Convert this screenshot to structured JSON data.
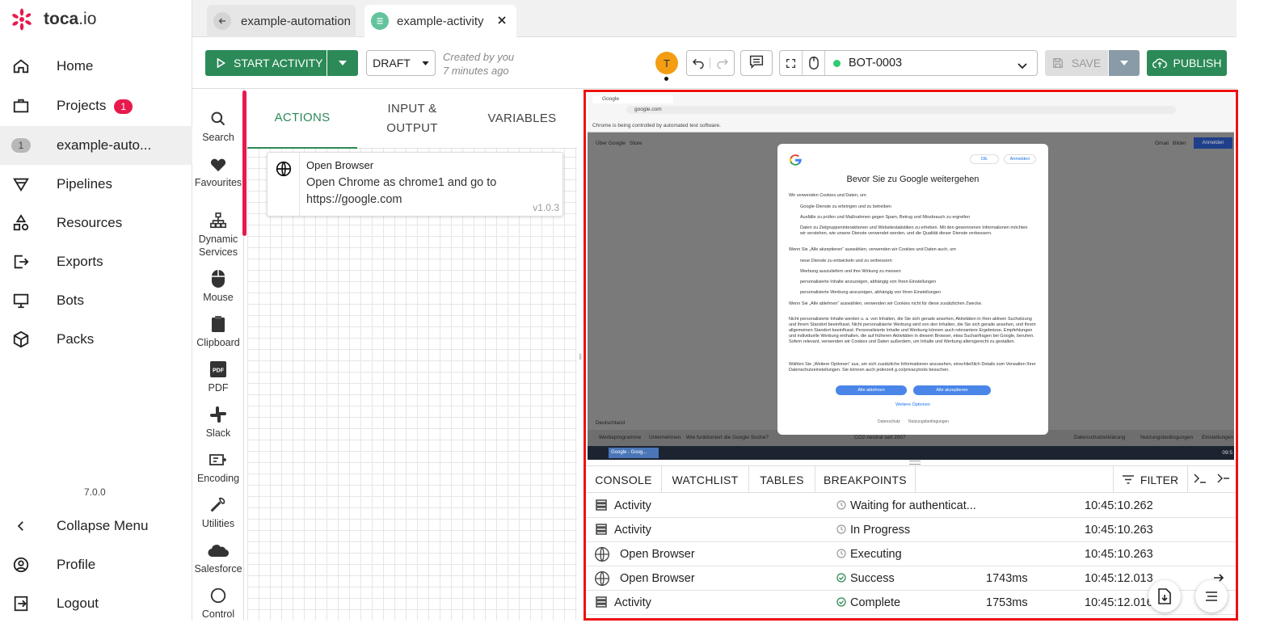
{
  "app": {
    "brand": "toca",
    "brand_suffix": ".io",
    "version": "7.0.0"
  },
  "nav": {
    "items": [
      {
        "label": "Home",
        "icon": "home-icon"
      },
      {
        "label": "Projects",
        "icon": "briefcase-icon",
        "badge": "1"
      },
      {
        "label": "example-auto...",
        "icon": "number-badge",
        "badge": "1"
      },
      {
        "label": "Pipelines",
        "icon": "pipeline-icon"
      },
      {
        "label": "Resources",
        "icon": "shapes-icon"
      },
      {
        "label": "Exports",
        "icon": "export-icon"
      },
      {
        "label": "Bots",
        "icon": "monitor-icon"
      },
      {
        "label": "Packs",
        "icon": "package-icon"
      }
    ],
    "collapse": "Collapse Menu",
    "profile": "Profile",
    "logout": "Logout"
  },
  "tabs": {
    "back_tab": "example-automation",
    "active_tab": "example-activity"
  },
  "toolbar": {
    "start": "START ACTIVITY",
    "draft": "DRAFT",
    "created_line1": "Created by you",
    "created_line2": "7 minutes ago",
    "avatar_initial": "T",
    "bot": "BOT-0003",
    "save": "SAVE",
    "publish": "PUBLISH",
    "colors": {
      "green": "#2b8a57",
      "accent": "#e8194d",
      "avatar": "#f29d12",
      "status_dot": "#2ecc71"
    }
  },
  "palette": [
    {
      "label": "Search",
      "icon": "search-icon"
    },
    {
      "label": "Favourites",
      "icon": "heart-icon"
    },
    {
      "label": "Dynamic Services",
      "icon": "hierarchy-icon"
    },
    {
      "label": "Mouse",
      "icon": "mouse-icon"
    },
    {
      "label": "Clipboard",
      "icon": "clipboard-icon"
    },
    {
      "label": "PDF",
      "icon": "pdf-icon"
    },
    {
      "label": "Slack",
      "icon": "slack-icon"
    },
    {
      "label": "Encoding",
      "icon": "encoding-icon"
    },
    {
      "label": "Utilities",
      "icon": "wrench-icon"
    },
    {
      "label": "Salesforce",
      "icon": "cloud-icon"
    },
    {
      "label": "Control",
      "icon": "circle-icon"
    }
  ],
  "actions_panel": {
    "tabs": [
      "ACTIONS",
      "INPUT & OUTPUT",
      "VARIABLES"
    ],
    "card": {
      "title": "Open Browser",
      "desc": "Open Chrome as chrome1 and go to https://google.com",
      "version": "v1.0.3"
    }
  },
  "preview": {
    "browser_tab": "Google",
    "url": "google.com",
    "automation_notice": "Chrome is being controlled by automated test software.",
    "header_links": [
      "Über Google",
      "Store"
    ],
    "header_right": [
      "Gmail",
      "Bilder"
    ],
    "sign_in": "Anmelden",
    "dialog": {
      "lang": "DE",
      "signin": "Anmelden",
      "title": "Bevor Sie zu Google weitergehen",
      "intro": "Wir verwenden Cookies und Daten, um",
      "list1": [
        "Google-Dienste zu erbringen und zu betreiben",
        "Ausfälle zu prüfen und Maßnahmen gegen Spam, Betrug und Missbrauch zu ergreifen",
        "Daten zu Zielgruppeninteraktionen und Websitestatistiken zu erheben. Mit den gewonnenen Informationen möchten wir verstehen, wie unsere Dienste verwendet werden, und die Qualität dieser Dienste verbessern."
      ],
      "accept_heading": "Wenn Sie „Alle akzeptieren“ auswählen, verwenden wir Cookies und Daten auch, um",
      "list2": [
        "neue Dienste zu entwickeln und zu verbessern",
        "Werbung auszuliefern und ihre Wirkung zu messen",
        "personalisierte Inhalte anzuzeigen, abhängig von Ihren Einstellungen",
        "personalisierte Werbung anzuzeigen, abhängig von Ihren Einstellungen"
      ],
      "reject_heading": "Wenn Sie „Alle ablehnen“ auswählen, verwenden wir Cookies nicht für diese zusätzlichen Zwecke.",
      "para1": "Nicht personalisierte Inhalte werden u. a. von Inhalten, die Sie sich gerade ansehen, Aktivitäten in Ihrer aktiven Suchsitzung und Ihrem Standort beeinflusst. Nicht personalisierte Werbung wird von den Inhalten, die Sie sich gerade ansehen, und Ihrem allgemeinen Standort beeinflusst. Personalisierte Inhalte und Werbung können auch relevantere Ergebnisse, Empfehlungen und individuelle Werbung enthalten, die auf früheren Aktivitäten in diesem Browser, etwa Suchanfragen bei Google, beruhen. Sofern relevant, verwenden wir Cookies und Daten außerdem, um Inhalte und Werbung altersgerecht zu gestalten.",
      "para2": "Wählen Sie „Weitere Optionen“ aus, um sich zusätzliche Informationen anzusehen, einschließlich Details zum Verwalten Ihrer Datenschutzeinstellungen. Sie können auch jederzeit g.co/privacytools besuchen.",
      "reject": "Alle ablehnen",
      "accept": "Alle akzeptieren",
      "more": "Weitere Optionen",
      "footer1": "Datenschutz",
      "footer2": "Nutzungsbedingungen"
    },
    "footer_left": "Deutschland",
    "footer_links": [
      "Werbeprogramme",
      "Unternehmen",
      "Wie funktioniert die Google Suche?"
    ],
    "footer_mid": "CO2-neutral seit 2007",
    "footer_right": [
      "Datenschutzerklärung",
      "Nutzungsbedingungen",
      "Einstellungen"
    ],
    "taskbar_item": "Google - Goog...",
    "taskbar_clock": "09:5"
  },
  "console": {
    "tabs": [
      "CONSOLE",
      "WATCHLIST",
      "TABLES",
      "BREAKPOINTS"
    ],
    "filter": "FILTER",
    "rows": [
      {
        "name": "Activity",
        "icon": "activity-icon",
        "status": "Waiting for authenticat...",
        "status_icon": "clock-icon",
        "duration": "",
        "time": "10:45:10.262"
      },
      {
        "name": "Activity",
        "icon": "activity-icon",
        "status": "In Progress",
        "status_icon": "clock-icon",
        "duration": "",
        "time": "10:45:10.263"
      },
      {
        "name": "Open Browser",
        "icon": "globe-icon",
        "status": "Executing",
        "status_icon": "clock-icon",
        "duration": "",
        "time": "10:45:10.263"
      },
      {
        "name": "Open Browser",
        "icon": "globe-icon",
        "status": "Success",
        "status_icon": "check-icon",
        "duration": "1743ms",
        "time": "10:45:12.013"
      },
      {
        "name": "Activity",
        "icon": "activity-icon",
        "status": "Complete",
        "status_icon": "check-icon",
        "duration": "1753ms",
        "time": "10:45:12.016"
      }
    ]
  }
}
